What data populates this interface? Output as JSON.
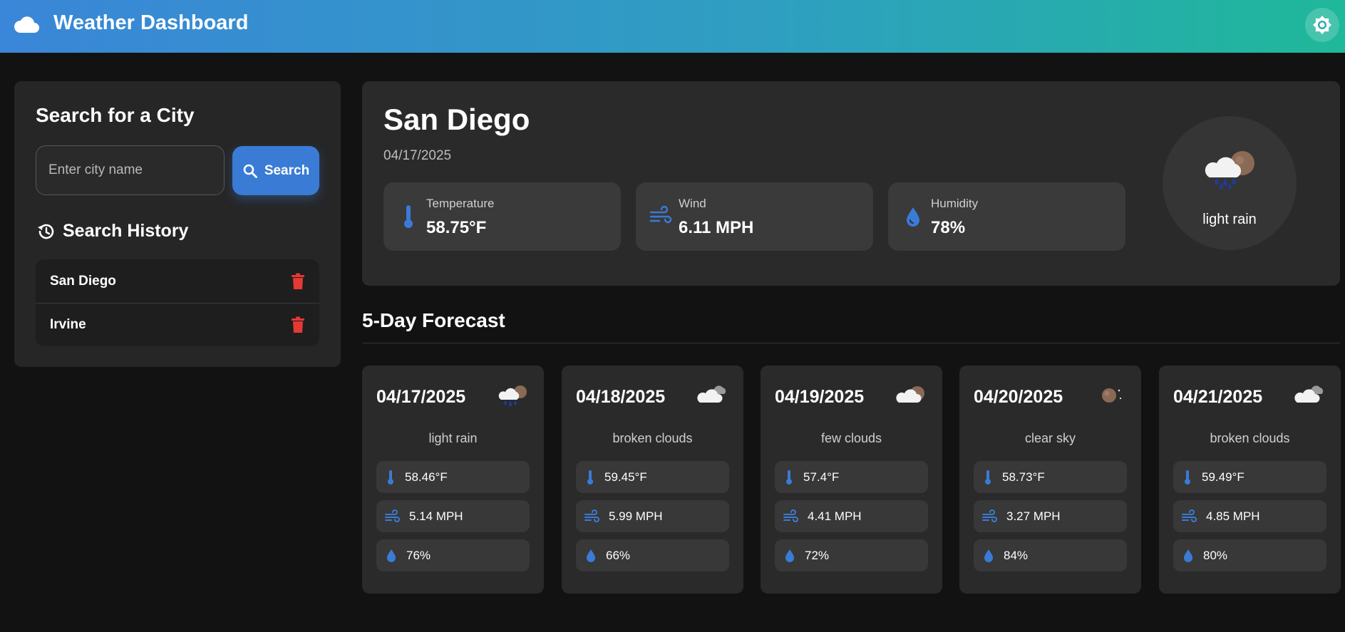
{
  "header": {
    "title": "Weather Dashboard"
  },
  "search": {
    "title": "Search for a City",
    "placeholder": "Enter city name",
    "button_label": "Search",
    "history_title": "Search History",
    "history": [
      {
        "city": "San Diego"
      },
      {
        "city": "Irvine"
      }
    ]
  },
  "current": {
    "city": "San Diego",
    "date": "04/17/2025",
    "temperature_label": "Temperature",
    "temperature": "58.75°F",
    "wind_label": "Wind",
    "wind": "6.11 MPH",
    "humidity_label": "Humidity",
    "humidity": "78%",
    "description": "light rain",
    "icon": "rain-sun-icon"
  },
  "forecast": {
    "title": "5-Day Forecast",
    "days": [
      {
        "date": "04/17/2025",
        "description": "light rain",
        "temp": "58.46°F",
        "wind": "5.14 MPH",
        "humidity": "76%",
        "icon": "rain-sun-icon"
      },
      {
        "date": "04/18/2025",
        "description": "broken clouds",
        "temp": "59.45°F",
        "wind": "5.99 MPH",
        "humidity": "66%",
        "icon": "broken-clouds-icon"
      },
      {
        "date": "04/19/2025",
        "description": "few clouds",
        "temp": "57.4°F",
        "wind": "4.41 MPH",
        "humidity": "72%",
        "icon": "few-clouds-icon"
      },
      {
        "date": "04/20/2025",
        "description": "clear sky",
        "temp": "58.73°F",
        "wind": "3.27 MPH",
        "humidity": "84%",
        "icon": "clear-sky-icon"
      },
      {
        "date": "04/21/2025",
        "description": "broken clouds",
        "temp": "59.49°F",
        "wind": "4.85 MPH",
        "humidity": "80%",
        "icon": "broken-clouds-icon"
      }
    ]
  },
  "colors": {
    "accent": "#3a7bd5",
    "delete": "#e53935",
    "header_start": "#3a86d8",
    "header_end": "#1fb89a"
  }
}
